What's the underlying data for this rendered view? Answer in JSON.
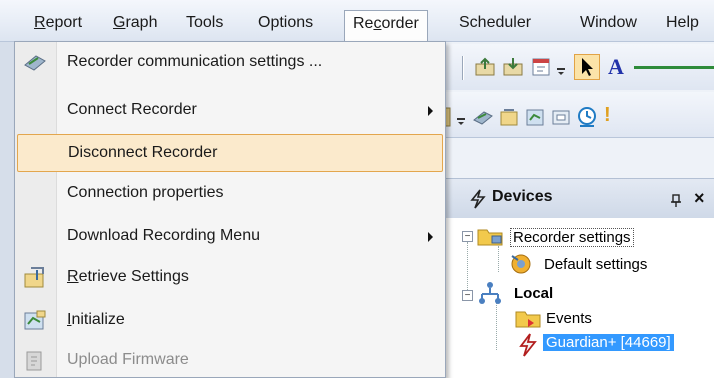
{
  "menubar": {
    "items": [
      {
        "label": "Report",
        "mnemonic": "R"
      },
      {
        "label": "Graph",
        "mnemonic": "G"
      },
      {
        "label": "Tools"
      },
      {
        "label": "Options"
      },
      {
        "label": "Recorder",
        "open": true
      },
      {
        "label": "Scheduler"
      },
      {
        "label": "Window"
      },
      {
        "label": "Help"
      }
    ]
  },
  "recorder_menu": {
    "items": [
      {
        "label": "Recorder communication settings ...",
        "icon": "recorder-settings-icon",
        "enabled": true
      },
      {
        "label": "Connect Recorder",
        "submenu": true,
        "enabled": true
      },
      {
        "label": "Disconnect Recorder",
        "highlighted": true,
        "enabled": true
      },
      {
        "label": "Connection properties",
        "enabled": true
      },
      {
        "label": "Download Recording Menu",
        "submenu": true,
        "enabled": true
      },
      {
        "label": "Retrieve Settings",
        "icon": "retrieve-settings-icon",
        "mnemonic": "R",
        "enabled": true
      },
      {
        "label": "Initialize",
        "icon": "initialize-icon",
        "mnemonic": "I",
        "enabled": true
      },
      {
        "label": "Upload Firmware",
        "icon": "upload-firmware-icon",
        "enabled": false
      }
    ]
  },
  "devices_panel": {
    "title": "Devices",
    "tree": [
      {
        "label": "Recorder settings",
        "expanded": true,
        "icon": "folder-settings-icon"
      },
      {
        "label": "Default settings",
        "icon": "default-settings-icon"
      },
      {
        "label": "Local",
        "bold": true,
        "expanded": true,
        "icon": "network-icon"
      },
      {
        "label": "Events",
        "icon": "folder-icon"
      },
      {
        "label": "Guardian+ [44669]",
        "selected": true,
        "icon": "device-icon"
      }
    ]
  },
  "colors": {
    "menu_highlight_bg": "#fbeacc",
    "menu_highlight_border": "#e3a64d",
    "selection_blue": "#3399ff",
    "menubar_bg": "#dde5f1"
  }
}
